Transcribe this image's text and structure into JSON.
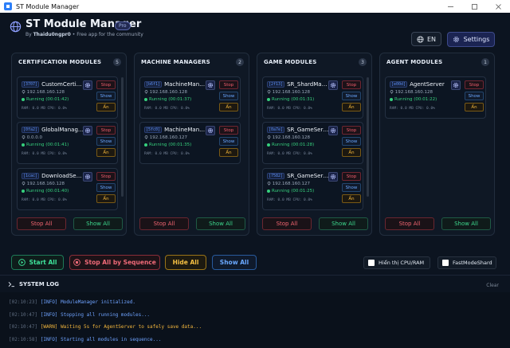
{
  "window": {
    "title": "ST Module Manager"
  },
  "header": {
    "app_title": "ST Module Manager",
    "badge": "Pro",
    "by_label": "By",
    "author": "Thaidu0ngpr0",
    "separator": "•",
    "tagline": "Free app for the community",
    "lang_label": "EN",
    "settings_label": "Settings"
  },
  "columns": [
    {
      "title": "CERTIFICATION MODULES",
      "count": "5",
      "stop_all": "Stop All",
      "show_all": "Show All",
      "cards": [
        {
          "pid": "[3707]",
          "name": "CustomCertific...",
          "ip": "192.168.160.128",
          "status": "Running (00:01:42)",
          "stats": "RAM: 0.0 MB  CPU: 0.0%"
        },
        {
          "pid": "[0fa2]",
          "name": "GlobalManager",
          "ip": "0.0.0.0",
          "status": "Running (00:01:41)",
          "stats": "RAM: 0.0 MB  CPU: 0.0%"
        },
        {
          "pid": "[1cac]",
          "name": "DownloadServer",
          "ip": "192.168.160.128",
          "status": "Running (00:01:40)",
          "stats": "RAM: 0.0 MB  CPU: 0.0%"
        }
      ]
    },
    {
      "title": "MACHINE MANAGERS",
      "count": "2",
      "stop_all": "Stop All",
      "show_all": "Show All",
      "cards": [
        {
          "pid": "[b6f1]",
          "name": "MachineManager",
          "ip": "192.168.160.128",
          "status": "Running (00:01:37)",
          "stats": "RAM: 0.0 MB  CPU: 0.0%"
        },
        {
          "pid": "[5fc0]",
          "name": "MachineManager2",
          "ip": "192.168.160.127",
          "status": "Running (00:01:35)",
          "stats": "RAM: 0.0 MB  CPU: 0.0%"
        }
      ]
    },
    {
      "title": "GAME MODULES",
      "count": "3",
      "stop_all": "Stop All",
      "show_all": "Show All",
      "cards": [
        {
          "pid": "[2f13]",
          "name": "SR_ShardMana...",
          "ip": "192.168.160.128",
          "status": "Running (00:01:31)",
          "stats": "RAM: 0.0 MB  CPU: 0.0%"
        },
        {
          "pid": "[0a7e]",
          "name": "SR_GameServer",
          "ip": "192.168.160.128",
          "status": "Running (00:01:28)",
          "stats": "RAM: 0.0 MB  CPU: 0.0%"
        },
        {
          "pid": "[7582]",
          "name": "SR_GameServer2",
          "ip": "192.168.160.127",
          "status": "Running (00:01:25)",
          "stats": "RAM: 0.0 MB  CPU: 0.0%"
        }
      ]
    },
    {
      "title": "AGENT MODULES",
      "count": "1",
      "stop_all": "Stop All",
      "show_all": "Show All",
      "cards": [
        {
          "pid": "[e00d]",
          "name": "AgentServer",
          "ip": "192.168.160.128",
          "status": "Running (00:01:22)",
          "stats": "RAM: 0.0 MB  CPU: 0.0%"
        }
      ]
    }
  ],
  "card_buttons": {
    "stop": "Stop",
    "show": "Show",
    "hide": "Ẩn"
  },
  "actions": {
    "start_all": "Start All",
    "stop_all_seq": "Stop All by Sequence",
    "hide_all": "Hide All",
    "show_all": "Show All",
    "show_cpu_ram": "Hiển thị CPU/RAM",
    "fast_mode": "FastModeShard"
  },
  "log": {
    "title": "SYSTEM LOG",
    "clear": "Clear",
    "entries": [
      {
        "time": "[02:10:23]",
        "level": "[INFO]",
        "msg": "ModuleManager initialized."
      },
      {
        "time": "[02:10:47]",
        "level": "[INFO]",
        "msg": "Stopping all running modules..."
      },
      {
        "time": "[02:10:47]",
        "level": "[WARN]",
        "msg": "Waiting 5s for AgentServer to safely save data..."
      },
      {
        "time": "[02:10:58]",
        "level": "[INFO]",
        "msg": "Starting all modules in sequence..."
      }
    ]
  },
  "colors": {
    "background": "#0c1420",
    "running": "#36d07d",
    "stop": "#ef5d6c",
    "show": "#69a7ff",
    "hide": "#f2b63a",
    "accent": "#5b8ff5"
  }
}
